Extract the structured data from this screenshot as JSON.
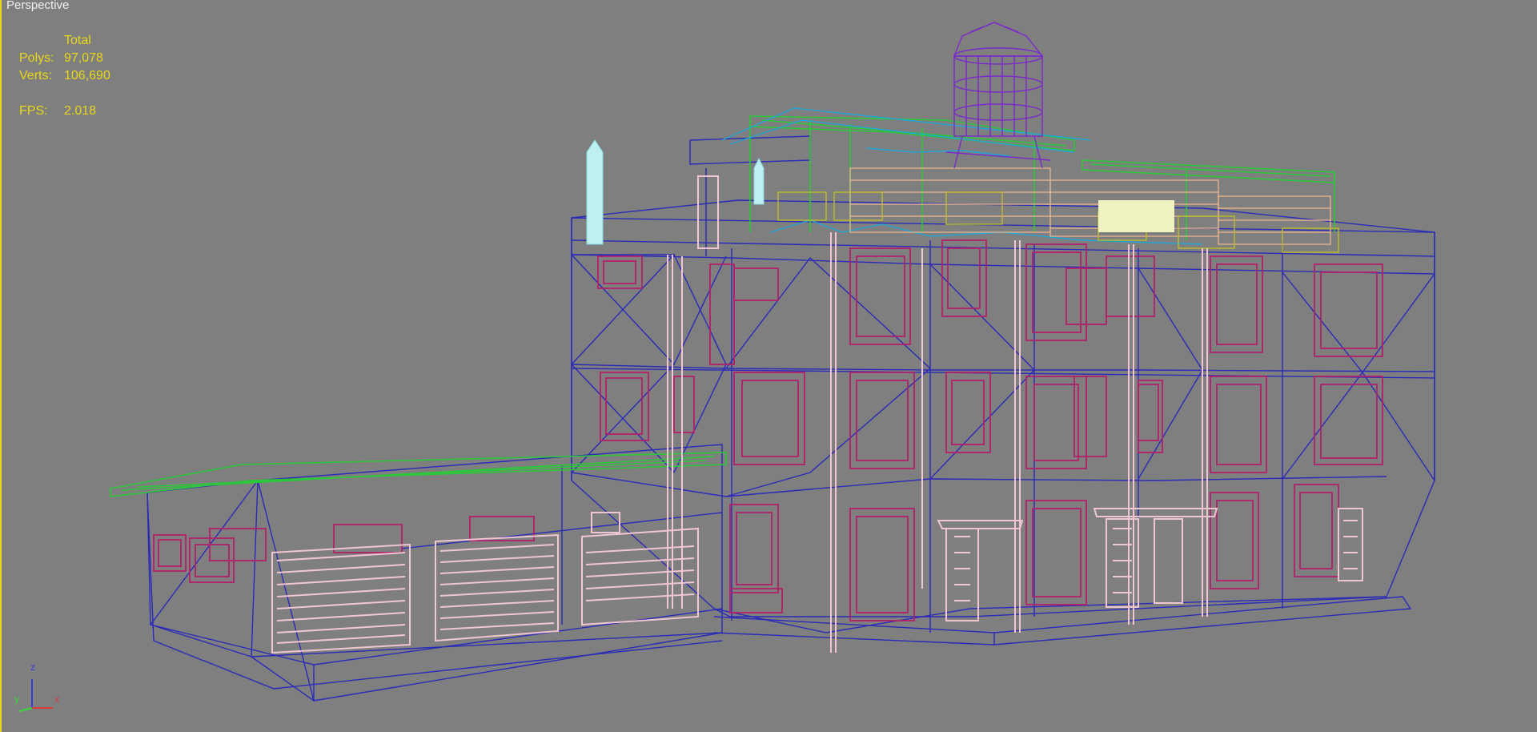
{
  "viewport": {
    "label": "Perspective",
    "stats": {
      "header": "Total",
      "polys_label": "Polys:",
      "polys_value": "97,078",
      "verts_label": "Verts:",
      "verts_value": "106,690",
      "fps_label": "FPS:",
      "fps_value": "2.018"
    },
    "axis": {
      "x": "x",
      "y": "y",
      "z": "z"
    }
  },
  "colors": {
    "background": "#7f7f7f",
    "stats_text": "#e8d818",
    "wire_blue": "#2a2ab8",
    "wire_magenta": "#b3206a",
    "wire_pink": "#f0c6d2",
    "wire_green": "#2cc83a",
    "wire_cyan": "#22a6d6",
    "wire_purple": "#7a2ac8",
    "wire_orange": "#f2b890",
    "wire_yellow": "#bcbc28",
    "active_border": "#e8d818"
  }
}
